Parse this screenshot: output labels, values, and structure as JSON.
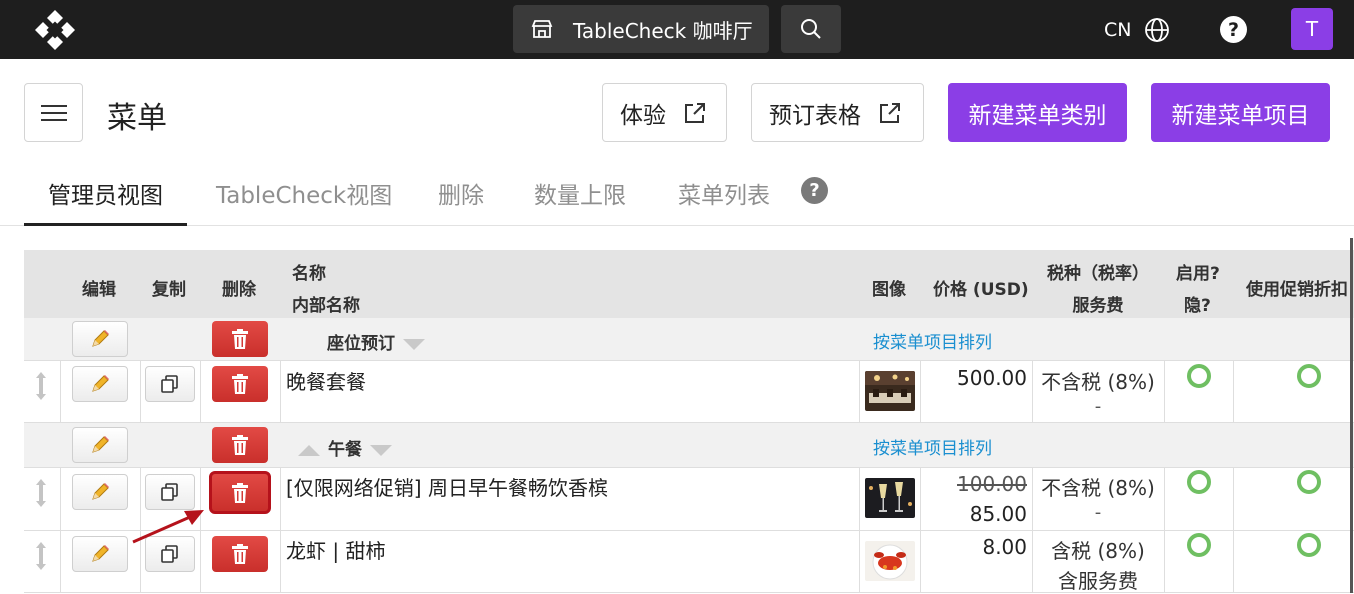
{
  "topbar": {
    "venue_name": "TableCheck 咖啡厅",
    "language": "CN",
    "help_label": "?",
    "avatar_initial": "T"
  },
  "header": {
    "title": "菜单",
    "experience_label": "体验",
    "booking_form_label": "预订表格",
    "new_category_label": "新建菜单类别",
    "new_item_label": "新建菜单项目"
  },
  "tabs": {
    "admin_view": "管理员视图",
    "tablecheck_view": "TableCheck视图",
    "delete": "删除",
    "quantity_limit": "数量上限",
    "menu_list": "菜单列表",
    "help": "?"
  },
  "table": {
    "headers": {
      "edit": "编辑",
      "copy": "复制",
      "delete": "删除",
      "name": "名称",
      "internal_name": "内部名称",
      "image": "图像",
      "price": "价格 (USD)",
      "tax": "税种（税率）",
      "service_fee": "服务费",
      "enabled": "启用?",
      "hidden": "隐?",
      "promo": "使用促销折扣"
    },
    "categories": [
      {
        "name": "座位预订",
        "sort_link": "按菜单项目排列"
      },
      {
        "name": "午餐",
        "sort_link": "按菜单项目排列"
      }
    ],
    "items": [
      {
        "name": "晚餐套餐",
        "price": "500.00",
        "tax": "不含税 (8%)",
        "service": "-"
      },
      {
        "name": "[仅限网络促销] 周日早午餐畅饮香槟",
        "original_price": "100.00",
        "price": "85.00",
        "tax": "不含税 (8%)",
        "service": "-"
      },
      {
        "name": "龙虾 | 甜柿",
        "price": "8.00",
        "tax": "含税 (8%)",
        "service": "含服务费"
      }
    ]
  },
  "colors": {
    "accent": "#8b3ee6",
    "delete": "#d33a36",
    "link": "#1a8fd0",
    "enabled": "#6fbf62",
    "topbar": "#1e1e1e"
  }
}
